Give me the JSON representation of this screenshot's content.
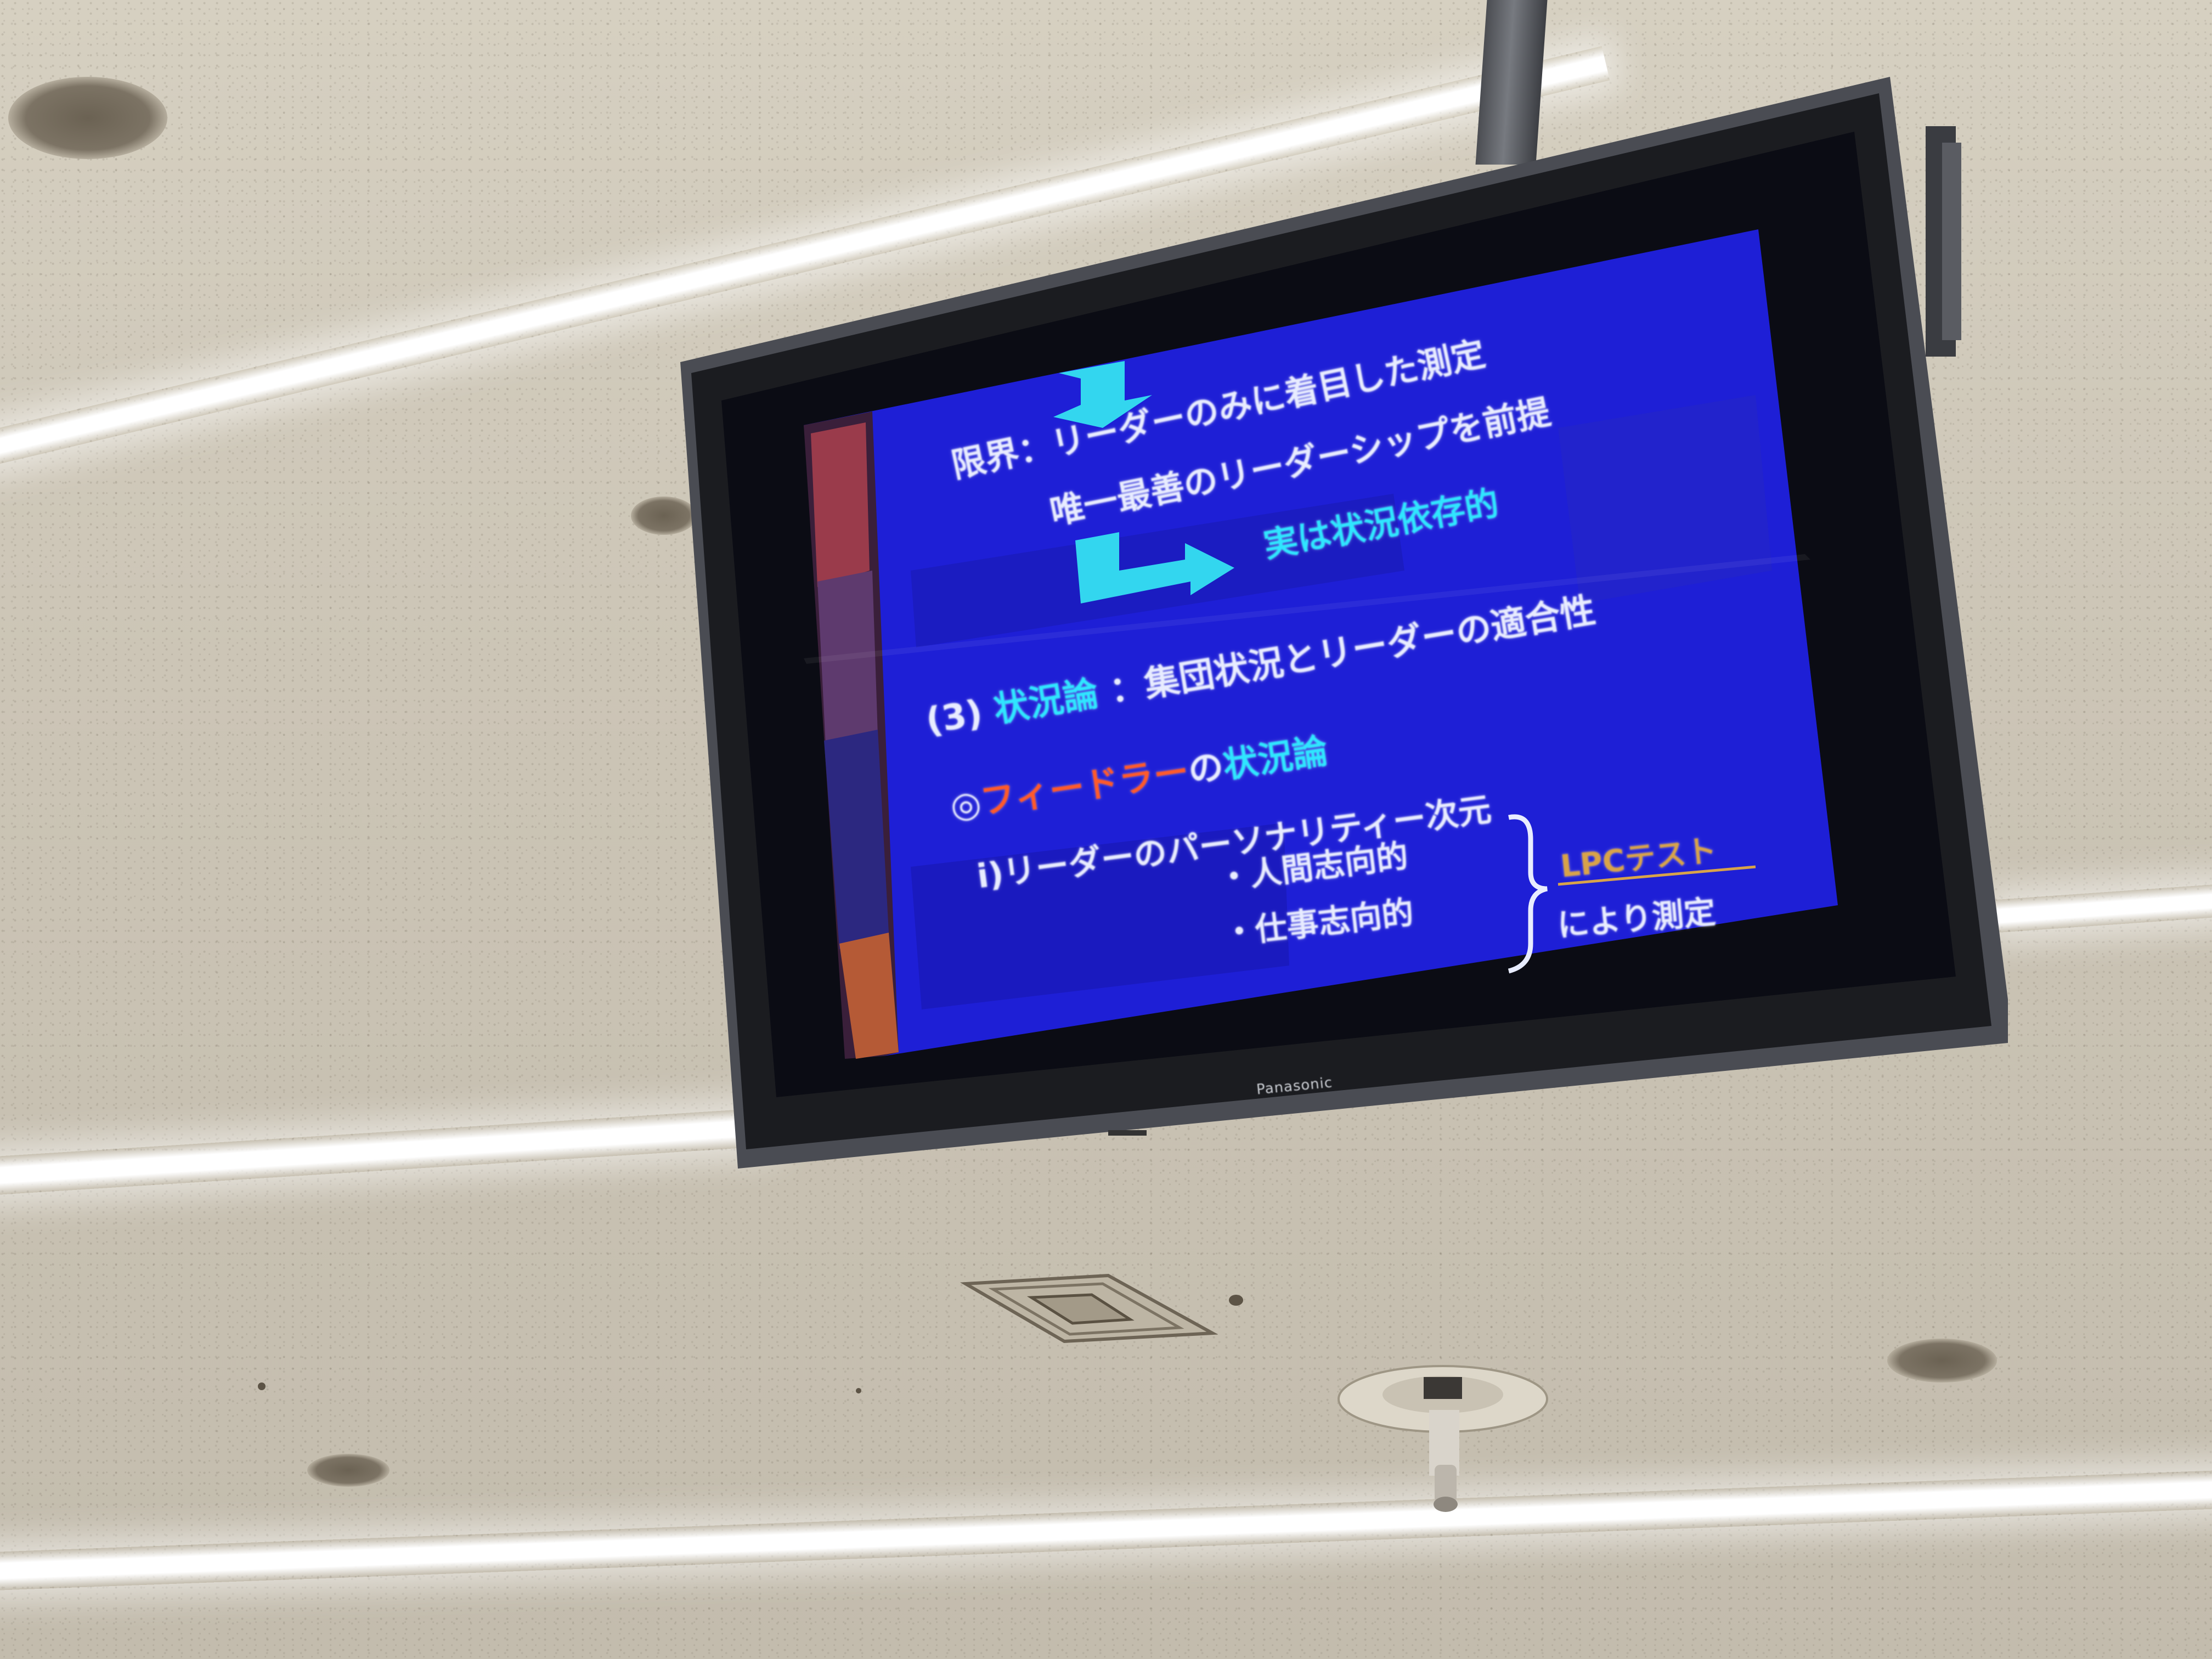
{
  "scene": {
    "description_tags": [
      "ceiling",
      "hanging-monitor",
      "fluorescent-lights",
      "presentation-slide"
    ]
  },
  "monitor": {
    "brand": "Panasonic"
  },
  "slide": {
    "line1": "リーダーのみに着目した測定",
    "line2": "限界：リーダーのみに着目した測定",
    "line2_prefix": "限界：",
    "line3": "唯一最善のリーダーシップを前提",
    "line4": "実は状況依存的",
    "line5": "(3) 状況論",
    "line5_number": "(3)",
    "line5_term": "状況論",
    "line5_desc": "：集団状況とリーダーの適合性",
    "line6_mark": "◎",
    "line6_name": "フィードラー",
    "line6_particle": "の",
    "line6_term": "状況論",
    "line7": "i)リーダーのパーソナリティー次元",
    "item1": "・人間志向的",
    "item2": "・仕事志向的",
    "brace_label": "LPCテスト",
    "brace_suffix": "により測定"
  },
  "colors": {
    "slide_bg": "#1e1fd6",
    "text_white": "#e8ecff",
    "text_cyan": "#2fe6ff",
    "text_red": "#ff5a2a",
    "text_gold": "#d8a34a",
    "arrow": "#33d6ef",
    "bezel": "#1b1c20"
  }
}
